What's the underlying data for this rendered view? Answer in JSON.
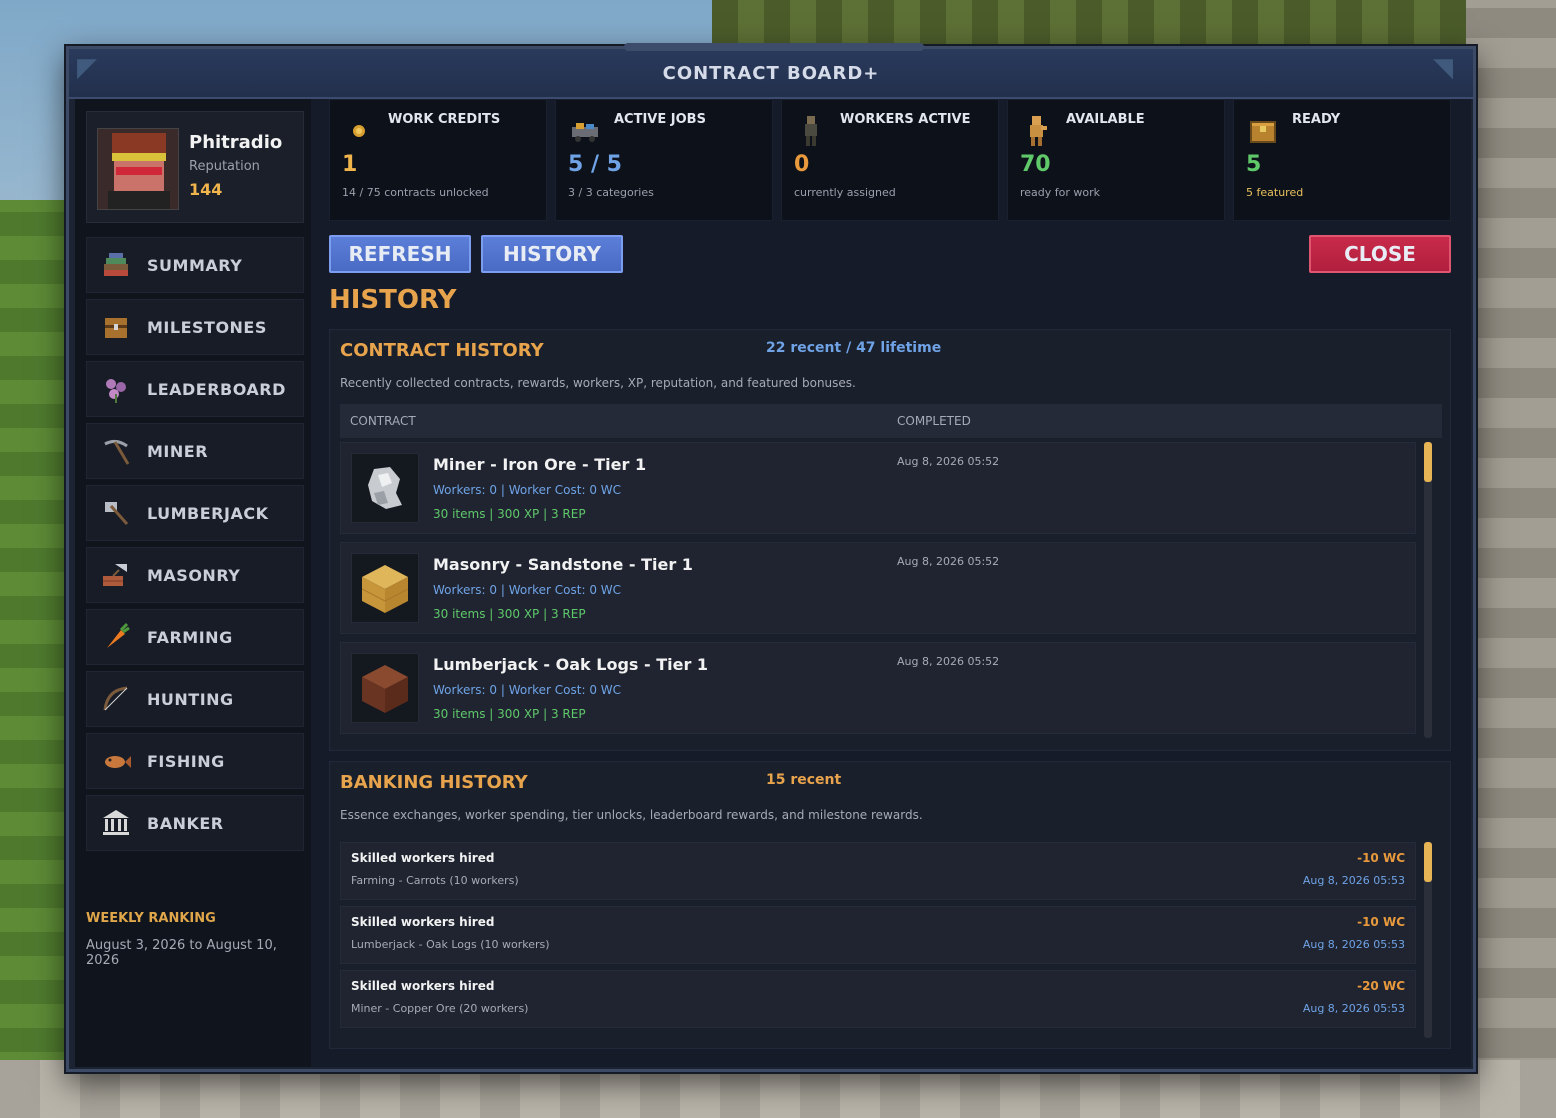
{
  "window": {
    "title": "CONTRACT BOARD+"
  },
  "profile": {
    "name": "Phitradio",
    "reputation_label": "Reputation",
    "reputation": "144"
  },
  "nav": [
    {
      "label": "SUMMARY",
      "icon": "books-icon"
    },
    {
      "label": "MILESTONES",
      "icon": "chest-icon"
    },
    {
      "label": "LEADERBOARD",
      "icon": "flower-icon"
    },
    {
      "label": "MINER",
      "icon": "pickaxe-icon"
    },
    {
      "label": "LUMBERJACK",
      "icon": "axe-icon"
    },
    {
      "label": "MASONRY",
      "icon": "trowel-icon"
    },
    {
      "label": "FARMING",
      "icon": "carrot-icon"
    },
    {
      "label": "HUNTING",
      "icon": "bow-icon"
    },
    {
      "label": "FISHING",
      "icon": "fish-icon"
    },
    {
      "label": "BANKER",
      "icon": "bank-icon"
    }
  ],
  "weekly": {
    "title": "WEEKLY RANKING",
    "range": "August 3, 2026 to August 10, 2026"
  },
  "stats": [
    {
      "label": "WORK CREDITS",
      "value": "1",
      "sub": "14 / 75 contracts unlocked",
      "icon": "coin-icon",
      "color": "#f0b44c"
    },
    {
      "label": "ACTIVE JOBS",
      "value": "5 / 5",
      "sub": "3 / 3 categories",
      "icon": "minecart-icon",
      "color": "#6fa3e6"
    },
    {
      "label": "WORKERS ACTIVE",
      "value": "0",
      "sub": "currently assigned",
      "icon": "worker-icon",
      "color": "#e89a3c"
    },
    {
      "label": "AVAILABLE",
      "value": "70",
      "sub": "ready for work",
      "icon": "idle-worker-icon",
      "color": "#5fc96a"
    },
    {
      "label": "READY",
      "value": "5",
      "sub": "5 featured",
      "icon": "crate-icon",
      "color": "#5fc96a"
    }
  ],
  "buttons": {
    "refresh": "REFRESH",
    "history": "HISTORY",
    "close": "CLOSE"
  },
  "page_title": "HISTORY",
  "contract_history": {
    "title": "CONTRACT HISTORY",
    "count": "22 recent / 47 lifetime",
    "description": "Recently collected contracts, rewards, workers, XP, reputation, and featured bonuses.",
    "columns": [
      "CONTRACT",
      "COMPLETED"
    ],
    "rows": [
      {
        "name": "Miner - Iron Ore - Tier 1",
        "workers": "Workers: 0 | Worker Cost: 0 WC",
        "rewards": "30 items | 300 XP | 3 REP",
        "completed": "Aug 8, 2026 05:52",
        "icon": "iron-ore-icon"
      },
      {
        "name": "Masonry - Sandstone - Tier 1",
        "workers": "Workers: 0 | Worker Cost: 0 WC",
        "rewards": "30 items | 300 XP | 3 REP",
        "completed": "Aug 8, 2026 05:52",
        "icon": "sandstone-icon"
      },
      {
        "name": "Lumberjack - Oak Logs - Tier 1",
        "workers": "Workers: 0 | Worker Cost: 0 WC",
        "rewards": "30 items | 300 XP | 3 REP",
        "completed": "Aug 8, 2026 05:52",
        "icon": "oak-log-icon"
      }
    ]
  },
  "banking_history": {
    "title": "BANKING HISTORY",
    "count": "15 recent",
    "description": "Essence exchanges, worker spending, tier unlocks, leaderboard rewards, and milestone rewards.",
    "rows": [
      {
        "title": "Skilled workers hired",
        "detail": "Farming - Carrots (10 workers)",
        "amount": "-10 WC",
        "date": "Aug 8, 2026 05:53"
      },
      {
        "title": "Skilled workers hired",
        "detail": "Lumberjack - Oak Logs (10 workers)",
        "amount": "-10 WC",
        "date": "Aug 8, 2026 05:53"
      },
      {
        "title": "Skilled workers hired",
        "detail": "Miner - Copper Ore (20 workers)",
        "amount": "-20 WC",
        "date": "Aug 8, 2026 05:53"
      }
    ]
  }
}
